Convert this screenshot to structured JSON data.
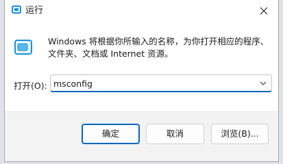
{
  "window": {
    "title": "运行",
    "title_icon": "run-icon",
    "close_icon": "close-icon"
  },
  "body": {
    "icon": "run-app-icon",
    "description_line1": "Windows 将根据你所输入的名称，为你打开相应的程序、",
    "description_line2": "文件夹、文档或 Internet 资源。",
    "open_label": "打开(O):",
    "open_value": "msconfig",
    "dropdown_icon": "chevron-down-icon"
  },
  "buttons": {
    "ok_label": "确定",
    "cancel_label": "取消",
    "browse_label": "浏览(B)..."
  },
  "colors": {
    "accent": "#0067c0",
    "icon_blue": "#1c8fd6",
    "footer_bg": "#f3f3f3"
  }
}
